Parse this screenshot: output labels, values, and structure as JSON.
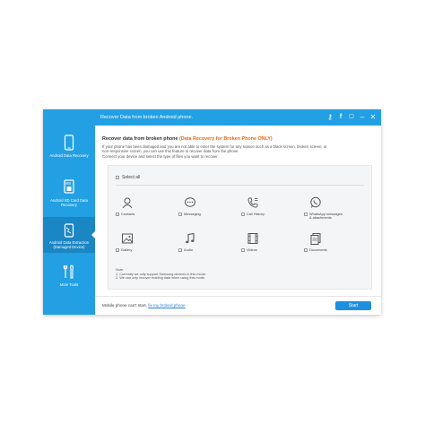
{
  "sidebar": {
    "items": [
      {
        "label": "Android Data Recovery",
        "icon": "phone-icon"
      },
      {
        "label": "Android SD Card Data Recovery",
        "icon": "sd-card-icon"
      },
      {
        "label": "Android Data Extraction (Damaged Device)",
        "icon": "damaged-phone-icon",
        "active": true
      },
      {
        "label": "More Tools",
        "icon": "tools-icon"
      }
    ]
  },
  "titlebar": {
    "title": "Recover Data from broken Android phone.",
    "icons": [
      "key-icon",
      "facebook-icon",
      "chat-icon",
      "minimize-icon",
      "close-icon"
    ]
  },
  "main": {
    "heading": "Recover data from broken phone",
    "heading_highlight": "(Data Recovery for Broken Phone ONLY)",
    "description_1": "If your phone has been damaged and you are not able to enter the system for any reason such as a black screen, broken screen, or",
    "description_2": "non-responsive screen, you can use this feature to recover data from the phone.",
    "description_3": "Connect your device and select the type of files you want to recover.",
    "select_all": "Select all",
    "file_types": [
      {
        "label": "Contacts",
        "icon": "contacts-icon"
      },
      {
        "label": "Messaging",
        "icon": "messaging-icon"
      },
      {
        "label": "Call History",
        "icon": "call-history-icon"
      },
      {
        "label": "WhatsApp messages & attachments",
        "icon": "whatsapp-icon"
      },
      {
        "label": "Gallery",
        "icon": "gallery-icon"
      },
      {
        "label": "Audio",
        "icon": "audio-icon"
      },
      {
        "label": "Videos",
        "icon": "video-icon"
      },
      {
        "label": "Documents",
        "icon": "documents-icon"
      }
    ],
    "note_title": "Note:",
    "note_1": "1. Currently we only support Samsung devices in this mode.",
    "note_2": "2. We can only recover existing data when using this mode."
  },
  "footer": {
    "message": "Mobile phone can't start,",
    "link": "fix my broked phone",
    "start_label": "Start"
  },
  "colors": {
    "accent": "#22a0e3",
    "highlight": "#e86a17",
    "button": "#1e8fe0"
  }
}
